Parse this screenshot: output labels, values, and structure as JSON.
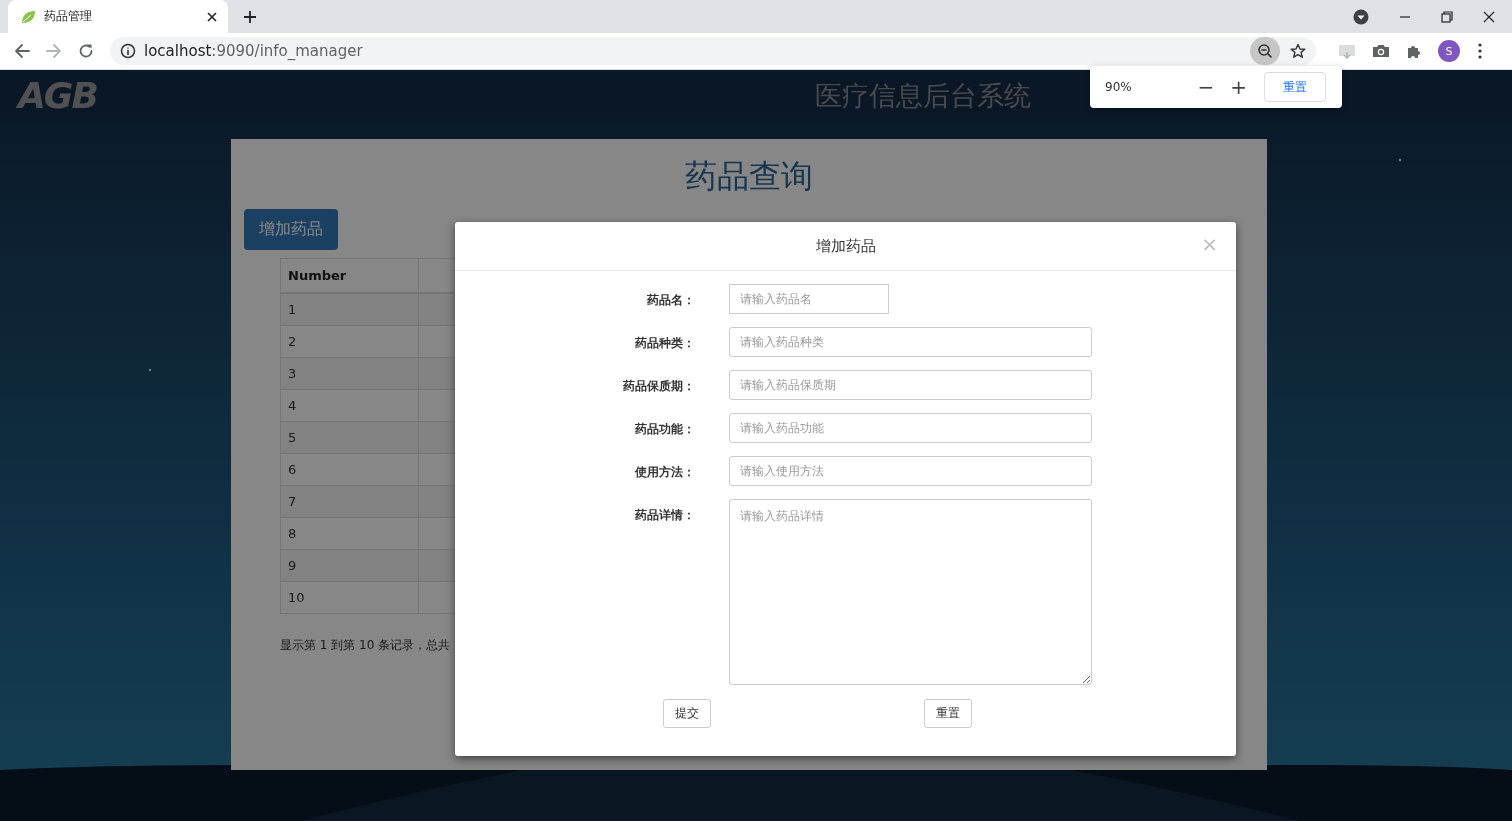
{
  "browser": {
    "tab": {
      "title": "药品管理"
    },
    "address": {
      "host": "localhost",
      "rest": ":9090/info_manager"
    },
    "profile_initial": "S",
    "zoom_popup": {
      "level": "90%",
      "minus": "−",
      "plus": "+",
      "reset": "重置"
    }
  },
  "header": {
    "logo": "AGB",
    "title": "医疗信息后台系统"
  },
  "page": {
    "title": "药品查询",
    "add_button": "增加药品",
    "table": {
      "columns": [
        "Number"
      ],
      "rows": [
        [
          "1"
        ],
        [
          "2"
        ],
        [
          "3"
        ],
        [
          "4"
        ],
        [
          "5"
        ],
        [
          "6"
        ],
        [
          "7"
        ],
        [
          "8"
        ],
        [
          "9"
        ],
        [
          "10"
        ]
      ]
    },
    "footer": "显示第 1 到第 10 条记录，总共"
  },
  "modal": {
    "title": "增加药品",
    "close": "×",
    "fields": [
      {
        "kind": "short",
        "label": "药品名：",
        "placeholder": "请输入药品名"
      },
      {
        "kind": "input",
        "label": "药品种类：",
        "placeholder": "请输入药品种类"
      },
      {
        "kind": "input",
        "label": "药品保质期：",
        "placeholder": "请输入药品保质期"
      },
      {
        "kind": "input",
        "label": "药品功能：",
        "placeholder": "请输入药品功能"
      },
      {
        "kind": "input",
        "label": "使用方法：",
        "placeholder": "请输入使用方法"
      },
      {
        "kind": "textarea",
        "label": "药品详情：",
        "placeholder": "请输入药品详情"
      }
    ],
    "buttons": [
      "提交",
      "重置"
    ]
  }
}
